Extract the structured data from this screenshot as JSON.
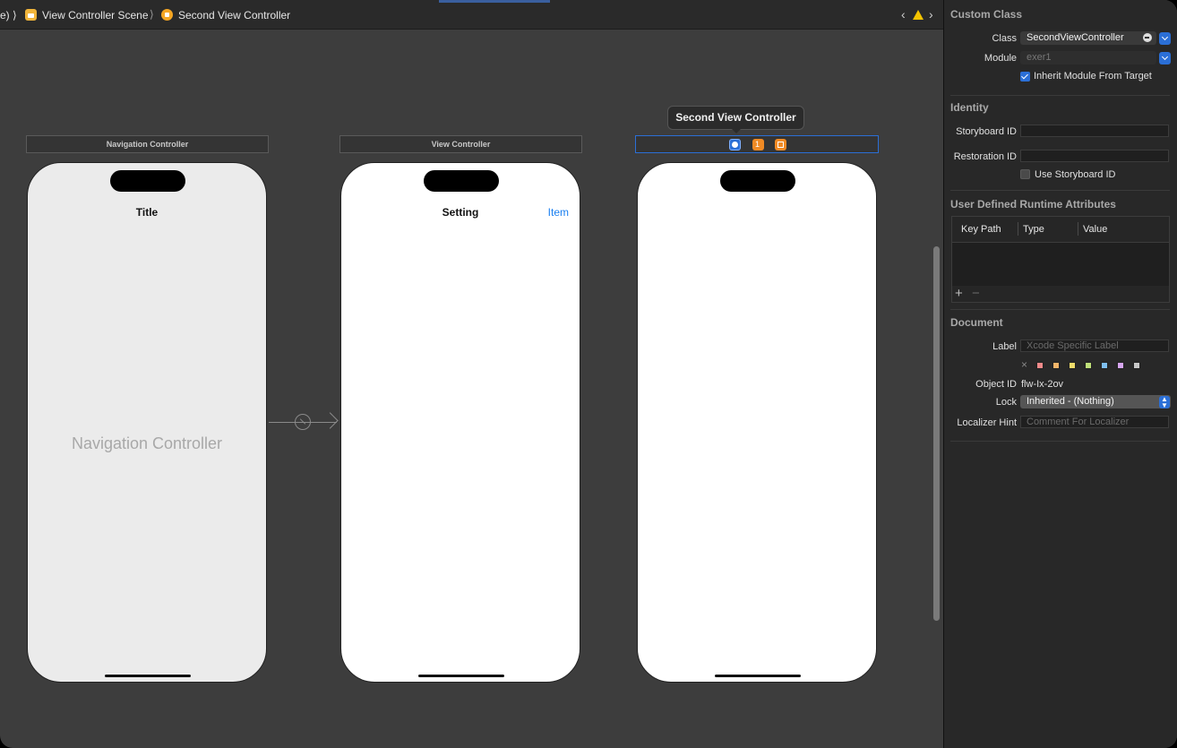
{
  "breadcrumb": {
    "partial": "e) ⟩",
    "scene": "View Controller Scene",
    "sep": "⟩",
    "current": "Second View Controller"
  },
  "canvas": {
    "nav_controller": {
      "bar_label": "Navigation Controller",
      "nav_title": "Title",
      "center_label": "Navigation Controller"
    },
    "view_controller": {
      "bar_label": "View Controller",
      "nav_title": "Setting",
      "nav_item": "Item"
    },
    "second_vc": {
      "tooltip": "Second View Controller"
    }
  },
  "inspector": {
    "custom_class": {
      "header": "Custom Class",
      "class_label": "Class",
      "class_value": "SecondViewController",
      "module_label": "Module",
      "module_value": "exer1",
      "inherit_label": "Inherit Module From Target",
      "inherit_checked": true
    },
    "identity": {
      "header": "Identity",
      "storyboard_id_label": "Storyboard ID",
      "storyboard_id_value": "",
      "restoration_id_label": "Restoration ID",
      "restoration_id_value": "",
      "use_storyboard_id_label": "Use Storyboard ID",
      "use_storyboard_id_checked": false
    },
    "udra": {
      "header": "User Defined Runtime Attributes",
      "columns": [
        "Key Path",
        "Type",
        "Value"
      ],
      "add": "+",
      "remove": "−"
    },
    "document": {
      "header": "Document",
      "label_label": "Label",
      "label_placeholder": "Xcode Specific Label",
      "clear": "×",
      "label_colors": [
        "#f08a8a",
        "#f3b56a",
        "#f0dc6a",
        "#bfe07a",
        "#7fbff0",
        "#d6a6f0",
        "#c8c8c8"
      ],
      "object_id_label": "Object ID",
      "object_id_value": "flw-Ix-2ov",
      "lock_label": "Lock",
      "lock_value": "Inherited - (Nothing)",
      "localizer_label": "Localizer Hint",
      "localizer_placeholder": "Comment For Localizer"
    }
  }
}
